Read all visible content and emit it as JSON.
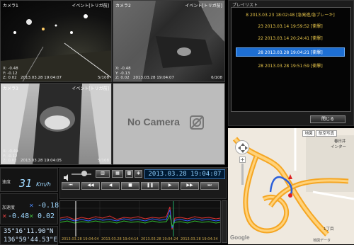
{
  "cameras": [
    {
      "title": "カメラ1",
      "event": "イベント[トリガ前]",
      "info": [
        "X: -0.48",
        "Y: -0.12",
        "Z: 0.02"
      ],
      "timestamp": "2013.03.28 19:04:07",
      "page": "5/108"
    },
    {
      "title": "カメラ2",
      "event": "イベント[トリガ前]",
      "info": [
        "X: -0.48",
        "Y: -0.13",
        "Z: 0.02"
      ],
      "timestamp": "2013.03.28 19:04:07",
      "page": "6/108"
    },
    {
      "title": "カメラ3",
      "event": "イベント[トリガ前]",
      "info": [
        "X: -0.49",
        "Y: -0.12",
        "Z: 0.02"
      ],
      "timestamp": "2013.03.28 19:04:05",
      "page": "5/108"
    },
    {
      "title": "",
      "event": "",
      "info": [],
      "timestamp": "",
      "page": ""
    }
  ],
  "no_camera_text": "No Camera",
  "playlist": {
    "title": "プレイリスト",
    "items": [
      {
        "num": "8",
        "text": "2013.03.23 18:02:48 [急発進/急ブレーキ]"
      },
      {
        "num": "23",
        "text": "2013.03.14 19:59:52 [衝撃]"
      },
      {
        "num": "22",
        "text": "2013.03.14 20:24:41 [衝撃]"
      },
      {
        "num": "28",
        "text": "2013.03.28 19:04:21 [衝撃]"
      },
      {
        "num": "28",
        "text": "2013.03.28 19:51:59 [衝撃]"
      }
    ],
    "selected_index": 3,
    "close_label": "閉じる"
  },
  "map": {
    "type_labels": [
      "地図",
      "航空写真"
    ],
    "labels": [
      "春日井",
      "インター",
      "1丁目",
      "地図データ"
    ],
    "logo": "Google"
  },
  "speed": {
    "label": "速度",
    "value": "31",
    "unit": "Km/h"
  },
  "sensor": {
    "label": "加速度",
    "x": "-0.18",
    "y": "-0.48",
    "z": "0.02"
  },
  "gps": {
    "lat": "35°16'11.90\"N",
    "lon": "136°59'44.53\"E"
  },
  "playback": {
    "datetime": "2013.03.28 19:04:07"
  },
  "graph": {
    "times": [
      "2013.03.28 19:04:04",
      "2013.03.28 19:04:14",
      "2013.03.28 19:04:24",
      "2013.03.28 19:04:34"
    ]
  }
}
